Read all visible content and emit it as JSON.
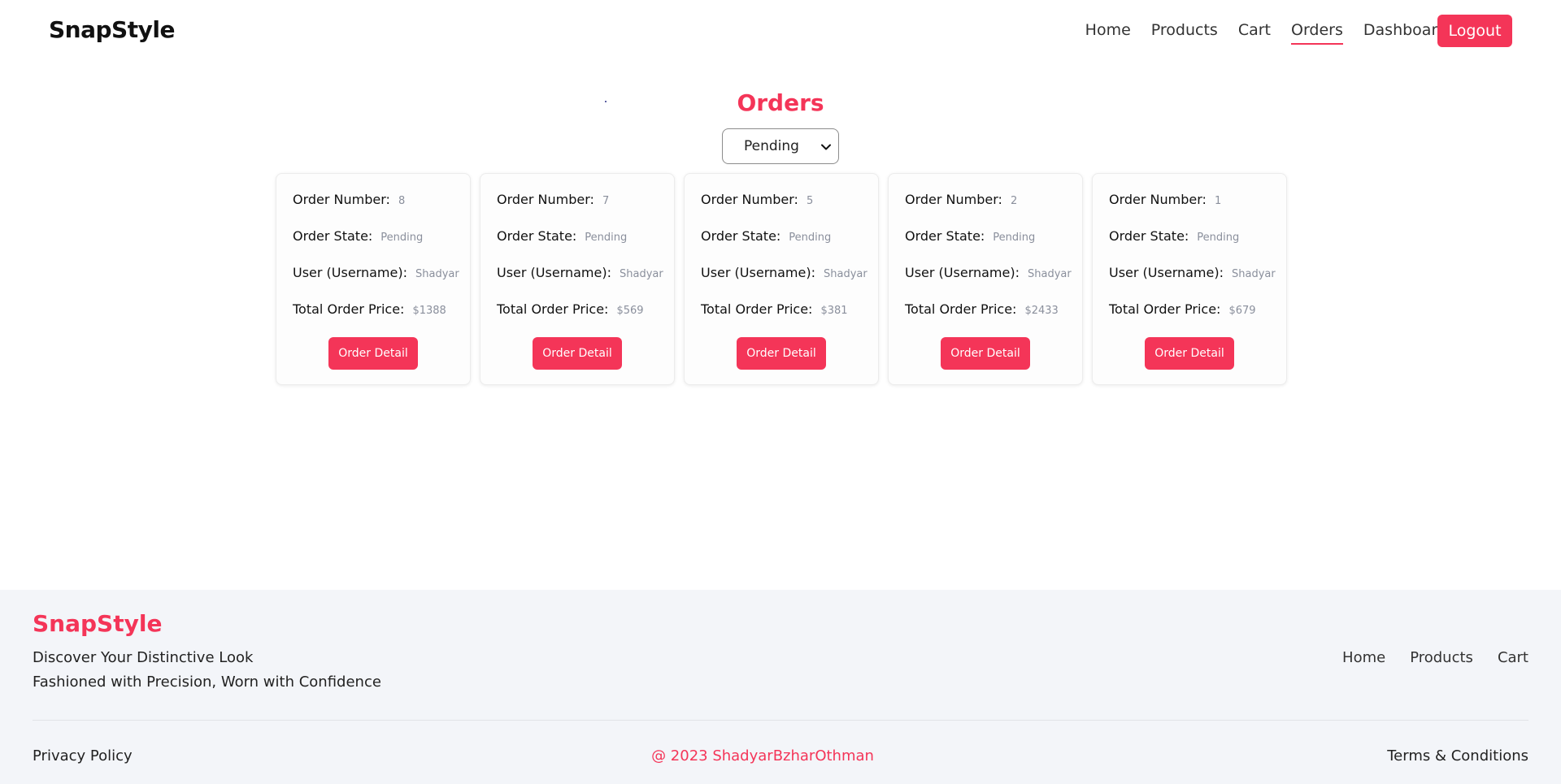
{
  "header": {
    "brand": "SnapStyle",
    "nav": [
      {
        "label": "Home",
        "active": false
      },
      {
        "label": "Products",
        "active": false
      },
      {
        "label": "Cart",
        "active": false
      },
      {
        "label": "Orders",
        "active": true
      },
      {
        "label": "Dashboard",
        "active": false
      }
    ],
    "logout_label": "Logout"
  },
  "colors": {
    "accent": "#f43558",
    "footer_bg": "#f3f5f9",
    "muted_value": "#8a8f9c"
  },
  "main": {
    "title": "Orders",
    "filter": {
      "selected": "Pending",
      "icon": "chevron-down-icon"
    },
    "labels": {
      "order_number": "Order Number:",
      "order_state": "Order State:",
      "user": "User (Username):",
      "total_price": "Total Order Price:",
      "detail_button": "Order Detail"
    },
    "orders": [
      {
        "number": "8",
        "state": "Pending",
        "user": "Shadyar",
        "total": "$1388"
      },
      {
        "number": "7",
        "state": "Pending",
        "user": "Shadyar",
        "total": "$569"
      },
      {
        "number": "5",
        "state": "Pending",
        "user": "Shadyar",
        "total": "$381"
      },
      {
        "number": "2",
        "state": "Pending",
        "user": "Shadyar",
        "total": "$2433"
      },
      {
        "number": "1",
        "state": "Pending",
        "user": "Shadyar",
        "total": "$679"
      }
    ]
  },
  "footer": {
    "brand": "SnapStyle",
    "tagline_line1": "Discover Your Distinctive Look",
    "tagline_line2": "Fashioned with Precision, Worn with Confidence",
    "nav": [
      "Home",
      "Products",
      "Cart"
    ],
    "privacy": "Privacy Policy",
    "copyright": "@ 2023 ShadyarBzharOthman",
    "terms": "Terms & Conditions"
  }
}
